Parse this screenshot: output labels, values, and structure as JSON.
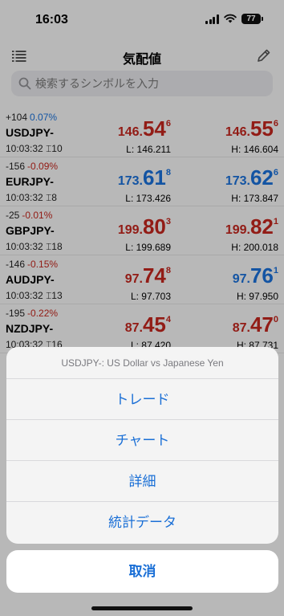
{
  "status_bar": {
    "time": "16:03",
    "battery": "77"
  },
  "nav": {
    "title": "気配値"
  },
  "search": {
    "placeholder": "検索するシンボルを入力"
  },
  "quotes": [
    {
      "change_points": "+104",
      "change_percent": "0.07%",
      "symbol": "USDJPY-",
      "time": "10:03:32",
      "spread": "10",
      "bid": {
        "pre": "146.",
        "big": "54",
        "sup": "6"
      },
      "ask": {
        "pre": "146.",
        "big": "55",
        "sup": "6"
      },
      "low": "L: 146.211",
      "high": "H: 146.604"
    },
    {
      "change_points": "-156",
      "change_percent": "-0.09%",
      "symbol": "EURJPY-",
      "time": "10:03:32",
      "spread": "8",
      "bid": {
        "pre": "173.",
        "big": "61",
        "sup": "8"
      },
      "ask": {
        "pre": "173.",
        "big": "62",
        "sup": "6"
      },
      "low": "L: 173.426",
      "high": "H: 173.847"
    },
    {
      "change_points": "-25",
      "change_percent": "-0.01%",
      "symbol": "GBPJPY-",
      "time": "10:03:32",
      "spread": "18",
      "bid": {
        "pre": "199.",
        "big": "80",
        "sup": "3"
      },
      "ask": {
        "pre": "199.",
        "big": "82",
        "sup": "1"
      },
      "low": "L: 199.689",
      "high": "H: 200.018"
    },
    {
      "change_points": "-146",
      "change_percent": "-0.15%",
      "symbol": "AUDJPY-",
      "time": "10:03:32",
      "spread": "13",
      "bid": {
        "pre": "97.",
        "big": "74",
        "sup": "8"
      },
      "ask": {
        "pre": "97.",
        "big": "76",
        "sup": "1"
      },
      "low": "L: 97.703",
      "high": "H: 97.950"
    },
    {
      "change_points": "-195",
      "change_percent": "-0.22%",
      "symbol": "NZDJPY-",
      "time": "10:03:32",
      "spread": "16",
      "bid": {
        "pre": "87.",
        "big": "45",
        "sup": "4"
      },
      "ask": {
        "pre": "87.",
        "big": "47",
        "sup": "0"
      },
      "low": "L: 87.420",
      "high": "H: 87.731"
    }
  ],
  "action_sheet": {
    "title": "USDJPY-: US Dollar vs Japanese Yen",
    "items": [
      "トレード",
      "チャート",
      "詳細",
      "統計データ"
    ],
    "cancel": "取消"
  },
  "colors": {
    "bid_color": "#c0261d",
    "ask_color_up": "#1a6fd6",
    "accent": "#1a6fd6"
  }
}
